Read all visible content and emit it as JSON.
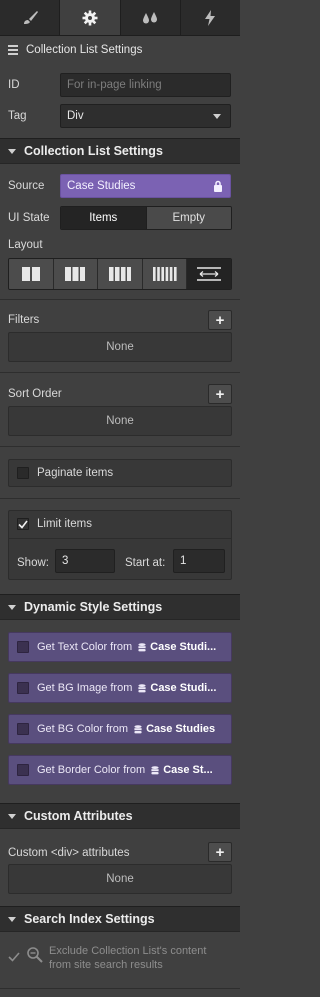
{
  "tabs": [
    {
      "name": "style",
      "icon": "paintbrush-icon",
      "active": false
    },
    {
      "name": "settings",
      "icon": "gear-icon",
      "active": true
    },
    {
      "name": "interactions",
      "icon": "drops-icon",
      "active": false
    },
    {
      "name": "lightning",
      "icon": "lightning-icon",
      "active": false
    }
  ],
  "selection": {
    "title": "Collection List Settings",
    "icon": "collection-list-icon"
  },
  "id_field": {
    "label": "ID",
    "value": "",
    "placeholder": "For in-page linking"
  },
  "tag_field": {
    "label": "Tag",
    "value": "Div"
  },
  "sections": {
    "collection": "Collection List Settings",
    "dynamic": "Dynamic Style Settings",
    "custom": "Custom Attributes",
    "search": "Search Index Settings"
  },
  "source": {
    "label": "Source",
    "value": "Case Studies",
    "icon": "lock-icon"
  },
  "ui_state": {
    "label": "UI State",
    "options": [
      "Items",
      "Empty"
    ],
    "selected": "Items"
  },
  "layout": {
    "label": "Layout",
    "options": [
      "1-column",
      "2-columns",
      "3-columns",
      "4-columns",
      "grid"
    ],
    "selected": "grid"
  },
  "filters": {
    "label": "Filters",
    "empty": "None"
  },
  "sort": {
    "label": "Sort Order",
    "empty": "None"
  },
  "paginate": {
    "label": "Paginate items",
    "checked": false
  },
  "limit": {
    "label": "Limit items",
    "checked": true,
    "show_label": "Show:",
    "show_value": "3",
    "start_label": "Start at:",
    "start_value": "1"
  },
  "dynamic_items": [
    {
      "prefix": "Get Text Color from",
      "source": "Case Studi..."
    },
    {
      "prefix": "Get BG Image from",
      "source": "Case Studi..."
    },
    {
      "prefix": "Get BG Color from",
      "source": "Case Studies"
    },
    {
      "prefix": "Get Border Color from",
      "source": "Case St..."
    }
  ],
  "custom_attributes": {
    "label": "Custom <div> attributes",
    "empty": "None"
  },
  "search_index": {
    "line1": "Exclude Collection List's content",
    "line2": "from site search results",
    "checked": true
  },
  "colors": {
    "accent_purple": "#7b62b3",
    "dynamic_bg": "#5a4f7e",
    "panel_bg": "#404040",
    "header_bg": "#2f2f2f"
  }
}
